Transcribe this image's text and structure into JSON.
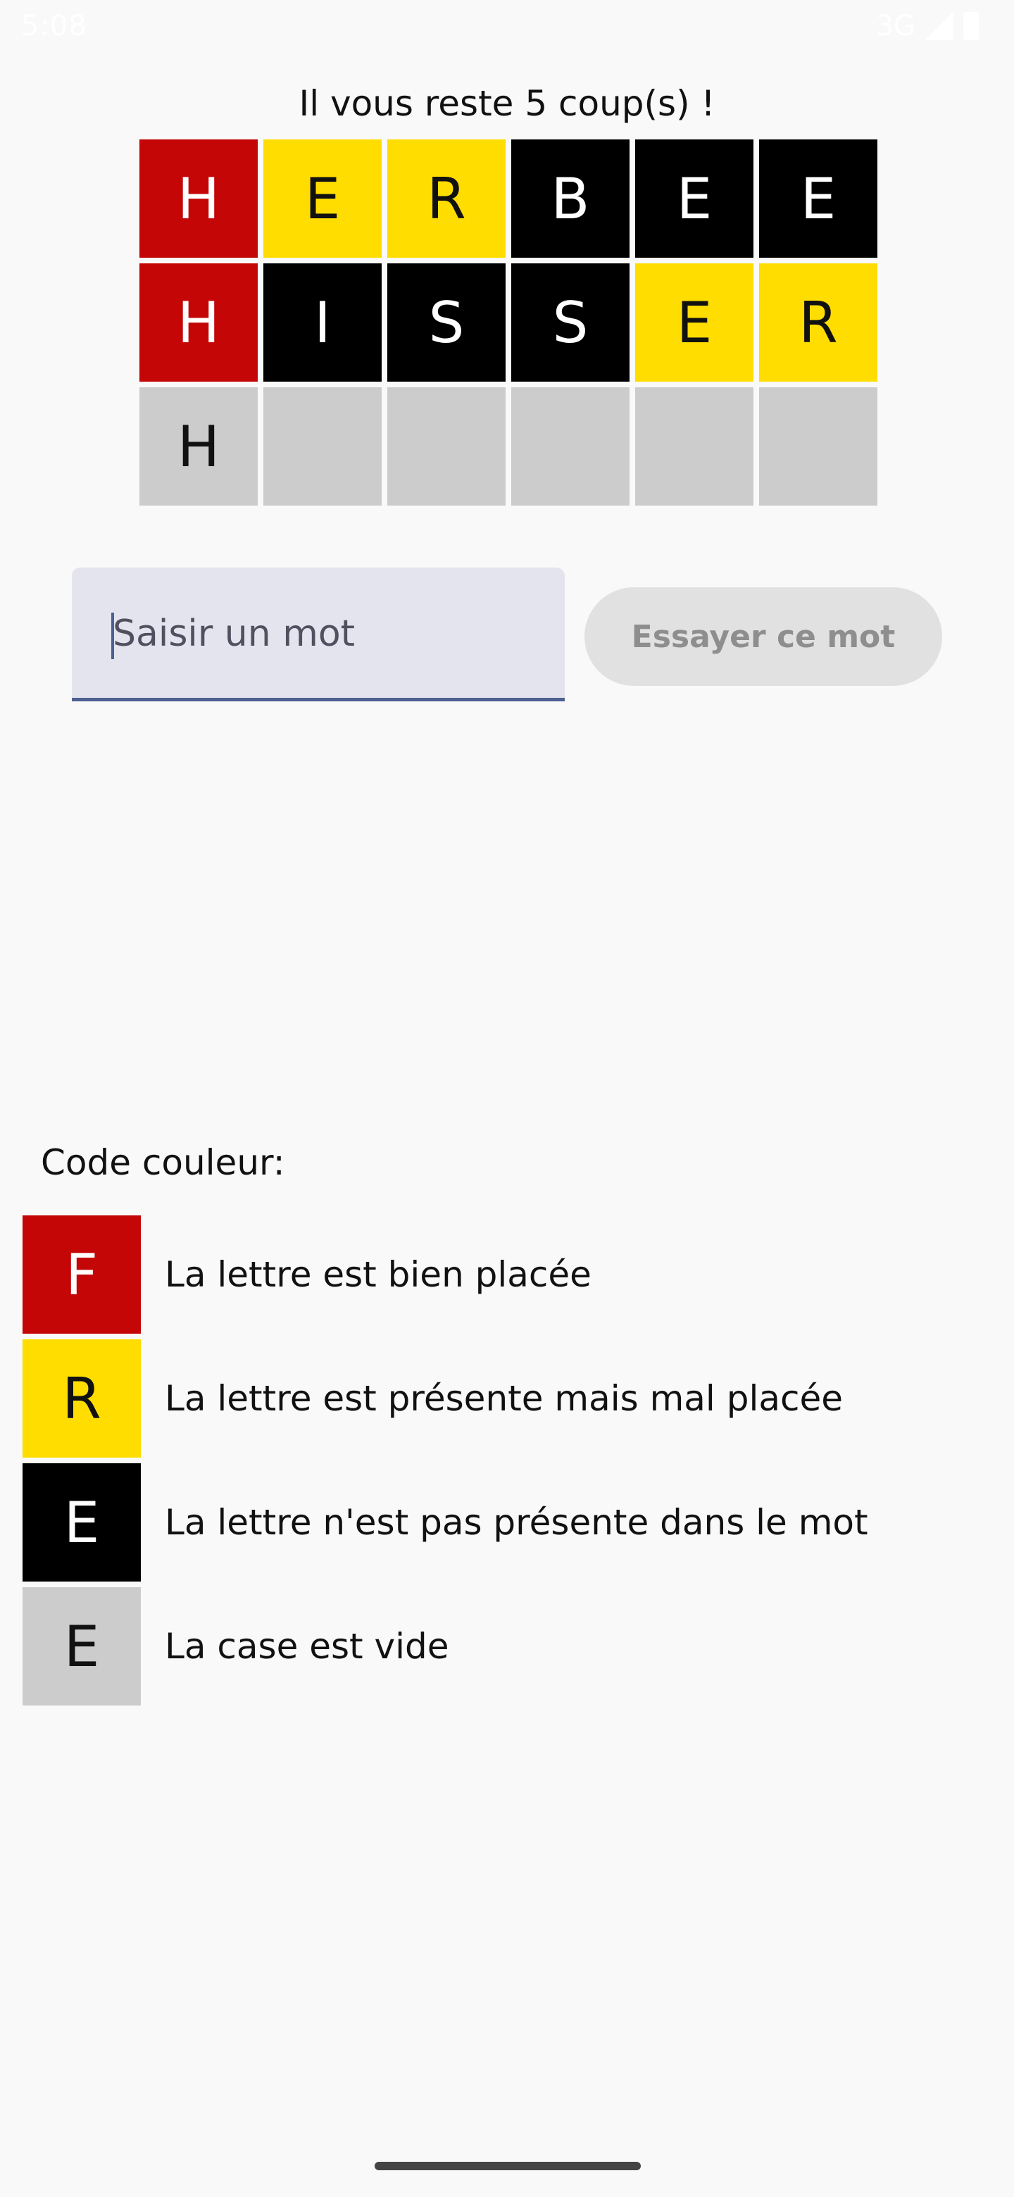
{
  "status_bar": {
    "time": "5:08",
    "network": "3G"
  },
  "game": {
    "remaining_text": "Il vous reste 5 coup(s) !",
    "grid": [
      [
        {
          "letter": "H",
          "state": "red"
        },
        {
          "letter": "E",
          "state": "yellow"
        },
        {
          "letter": "R",
          "state": "yellow"
        },
        {
          "letter": "B",
          "state": "black"
        },
        {
          "letter": "E",
          "state": "black"
        },
        {
          "letter": "E",
          "state": "black"
        }
      ],
      [
        {
          "letter": "H",
          "state": "red"
        },
        {
          "letter": "I",
          "state": "black"
        },
        {
          "letter": "S",
          "state": "black"
        },
        {
          "letter": "S",
          "state": "black"
        },
        {
          "letter": "E",
          "state": "yellow"
        },
        {
          "letter": "R",
          "state": "yellow"
        }
      ],
      [
        {
          "letter": "H",
          "state": "gray"
        },
        {
          "letter": "",
          "state": "gray"
        },
        {
          "letter": "",
          "state": "gray"
        },
        {
          "letter": "",
          "state": "gray"
        },
        {
          "letter": "",
          "state": "gray"
        },
        {
          "letter": "",
          "state": "gray"
        }
      ]
    ]
  },
  "input": {
    "value": "",
    "placeholder": "Saisir un mot"
  },
  "try_button": {
    "label": "Essayer ce mot"
  },
  "legend": {
    "title": "Code couleur:",
    "items": [
      {
        "letter": "F",
        "state": "red",
        "label": "La lettre est bien placée"
      },
      {
        "letter": "R",
        "state": "yellow",
        "label": "La lettre est présente mais mal placée"
      },
      {
        "letter": "E",
        "state": "black",
        "label": "La lettre n'est pas présente dans le mot"
      },
      {
        "letter": "E",
        "state": "gray",
        "label": "La case est vide"
      }
    ]
  },
  "colors": {
    "red": "#c40606",
    "yellow": "#ffdd00",
    "black": "#000000",
    "gray": "#cccccc",
    "accent": "#4e6091"
  }
}
